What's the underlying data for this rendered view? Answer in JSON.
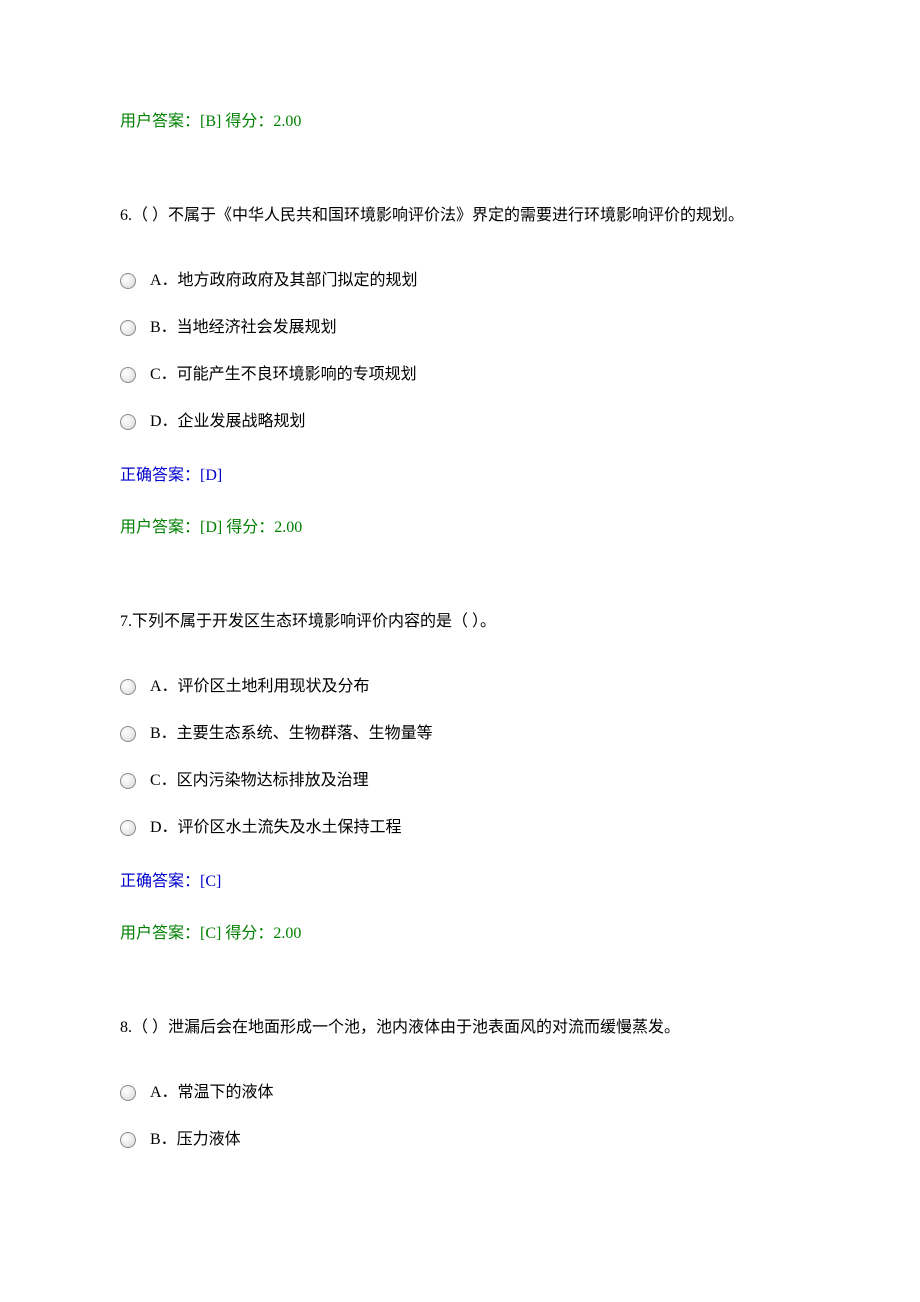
{
  "q5": {
    "user_answer": "用户答案：[B] 得分：2.00"
  },
  "q6": {
    "text": "6.（ ）不属于《中华人民共和国环境影响评价法》界定的需要进行环境影响评价的规划。",
    "options": {
      "a": "A．地方政府政府及其部门拟定的规划",
      "b": "B．当地经济社会发展规划",
      "c": "C．可能产生不良环境影响的专项规划",
      "d": "D．企业发展战略规划"
    },
    "correct": "正确答案：[D]",
    "user_answer": "用户答案：[D] 得分：2.00"
  },
  "q7": {
    "text": "7.下列不属于开发区生态环境影响评价内容的是（ ）。",
    "options": {
      "a": "A．评价区土地利用现状及分布",
      "b": "B．主要生态系统、生物群落、生物量等",
      "c": "C．区内污染物达标排放及治理",
      "d": "D．评价区水土流失及水土保持工程"
    },
    "correct": "正确答案：[C]",
    "user_answer": "用户答案：[C] 得分：2.00"
  },
  "q8": {
    "text": "8.（ ）泄漏后会在地面形成一个池，池内液体由于池表面风的对流而缓慢蒸发。",
    "options": {
      "a": "A．常温下的液体",
      "b": "B．压力液体"
    }
  }
}
